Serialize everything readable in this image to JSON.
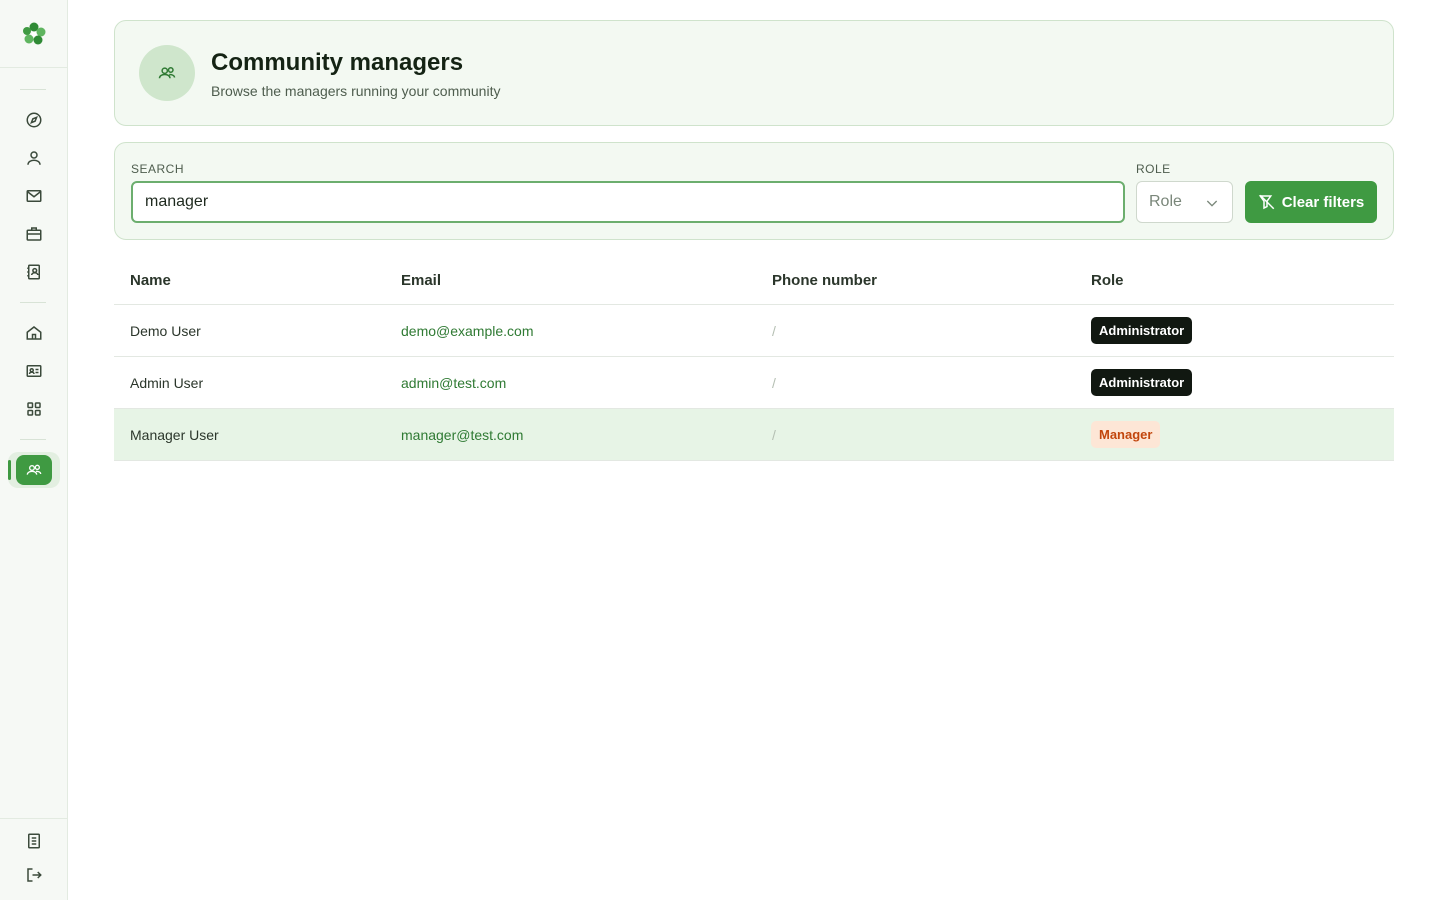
{
  "sidebar": {
    "logo_icon": "clover-logo-icon",
    "nav_top": [
      "compass-icon",
      "user-icon",
      "mail-icon",
      "briefcase-icon",
      "contact-book-icon"
    ],
    "nav_middle": [
      "home-icon",
      "id-card-icon",
      "grid-icon"
    ],
    "active_icon": "users-icon",
    "bottom": [
      "document-icon",
      "logout-icon"
    ],
    "accent": "#3f9a42"
  },
  "header": {
    "title": "Community managers",
    "subtitle": "Browse the managers running your community"
  },
  "filters": {
    "search_label": "SEARCH",
    "search_value": "manager",
    "role_label": "ROLE",
    "role_placeholder": "Role",
    "clear_label": "Clear filters"
  },
  "table": {
    "columns": [
      "Name",
      "Email",
      "Phone number",
      "Role"
    ],
    "rows": [
      {
        "name": "Demo User",
        "email": "demo@example.com",
        "phone": "/",
        "role": "Administrator"
      },
      {
        "name": "Admin User",
        "email": "admin@test.com",
        "phone": "/",
        "role": "Administrator"
      },
      {
        "name": "Manager User",
        "email": "manager@test.com",
        "phone": "/",
        "role": "Manager"
      }
    ]
  },
  "colors": {
    "admin_badge": "#111811",
    "manager_badge": "#fde6d6",
    "manager_text": "#c2460d",
    "email_link": "#2f7a33"
  }
}
